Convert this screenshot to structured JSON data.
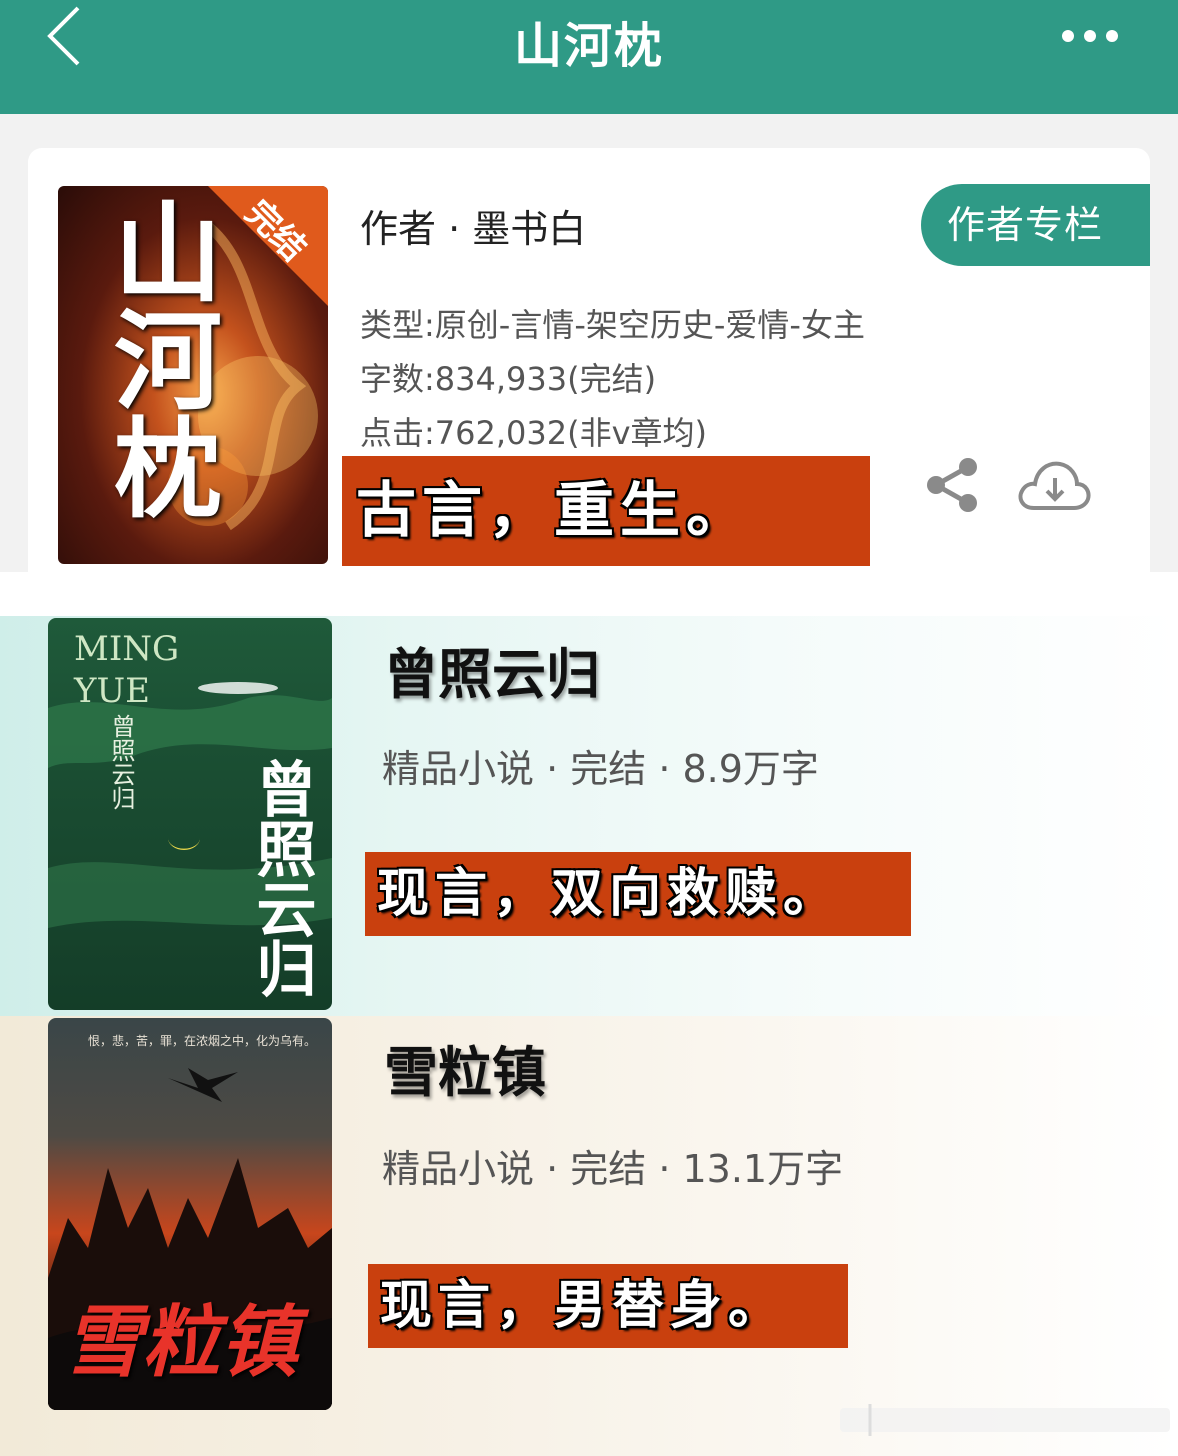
{
  "header": {
    "title": "山河枕",
    "back_icon": "chevron-left-icon",
    "more_icon": "more-dots-icon"
  },
  "book1": {
    "cover_badge": "完结",
    "cover_title": "山河枕",
    "author": "作者 · 墨书白",
    "author_button": "作者专栏",
    "type": "类型:原创-言情-架空历史-爱情-女主",
    "words": "字数:834,933(完结)",
    "clicks": "点击:762,032(非v章均)",
    "tag": "古言，重生。",
    "share_icon": "share-icon",
    "download_icon": "cloud-download-icon"
  },
  "book2": {
    "cover_en": "MING YUE",
    "cover_title": "曾照云归",
    "title": "曾照云归",
    "meta": "精品小说 · 完结 · 8.9万字",
    "tag": "现言，双向救赎。"
  },
  "book3": {
    "cover_top": "恨，悲，苦，罪，在浓烟之中，化为乌有。",
    "cover_title": "雪粒镇",
    "title": "雪粒镇",
    "meta": "精品小说 · 完结 · 13.1万字",
    "tag": "现言，男替身。"
  },
  "colors": {
    "accent": "#2f9a86",
    "tag_bg": "#c9400e"
  }
}
